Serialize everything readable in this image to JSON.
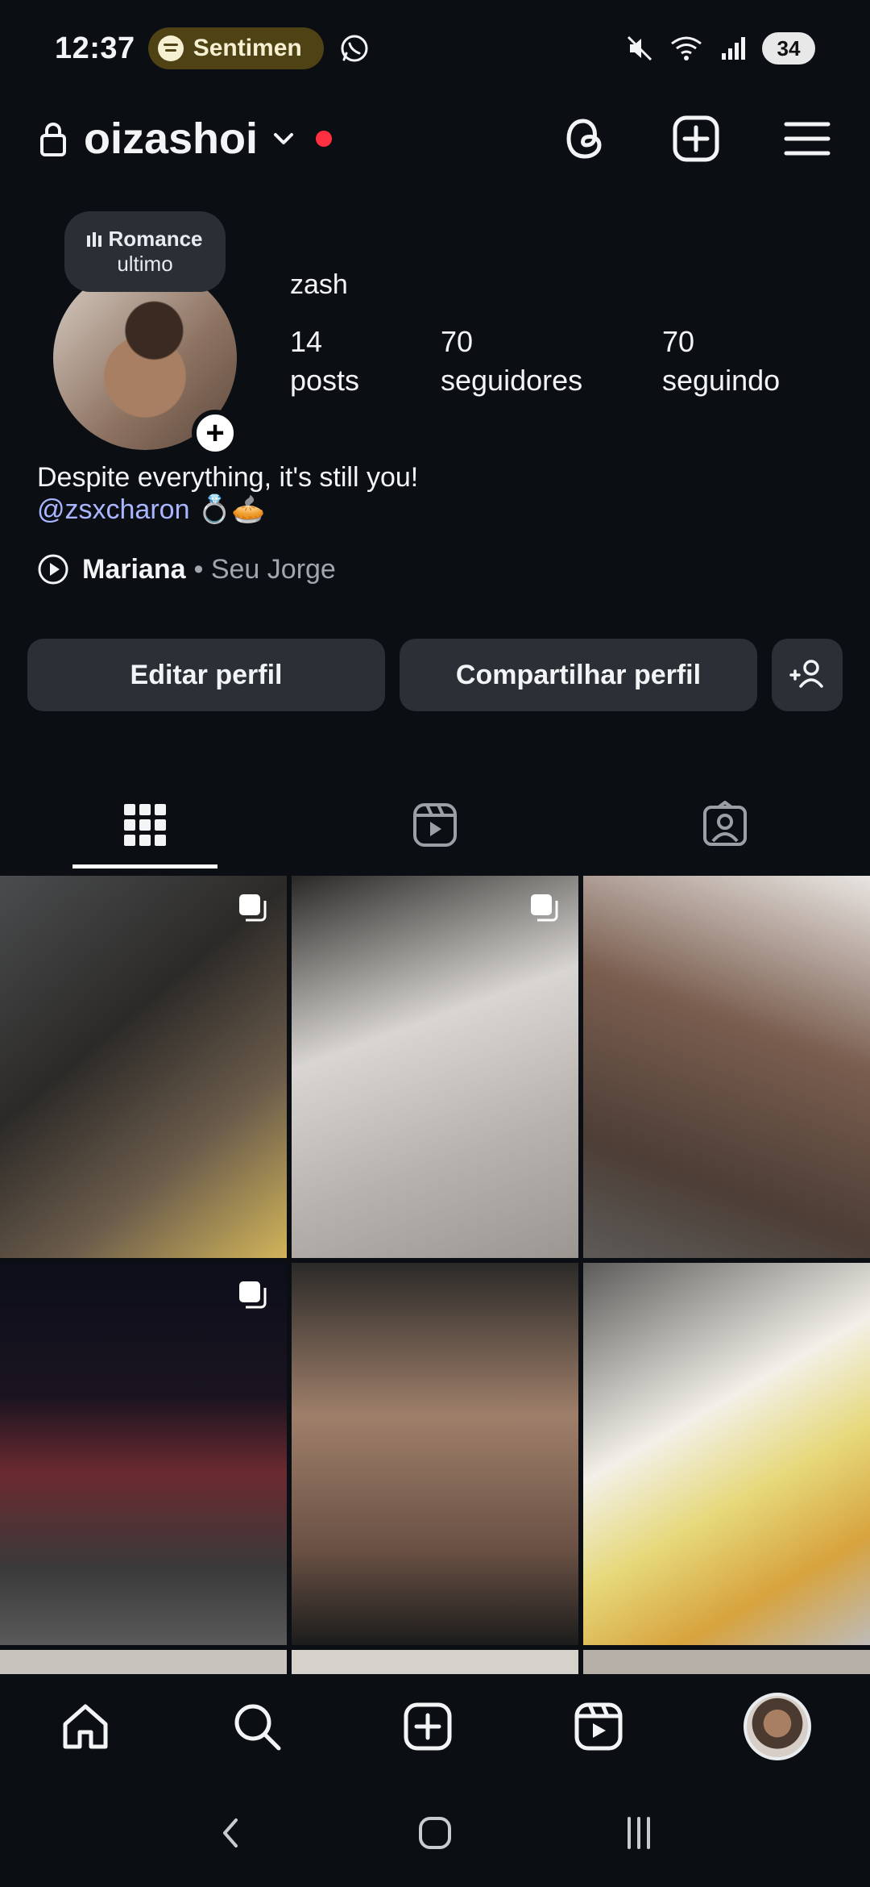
{
  "status_bar": {
    "time": "12:37",
    "spotify_text": "Sentimen",
    "battery": "34"
  },
  "header": {
    "username": "oizashoi"
  },
  "profile": {
    "note_title": "Romance",
    "note_sub": "ultimo",
    "display_name": "zash",
    "stats": [
      {
        "value": "14",
        "label": "posts"
      },
      {
        "value": "70",
        "label": "seguidores"
      },
      {
        "value": "70",
        "label": "seguindo"
      }
    ],
    "bio_line1": "Despite everything, it's still you!",
    "bio_mention": "@zsxcharon",
    "bio_emojis": "💍🥧",
    "music_song": "Mariana",
    "music_artist": "• Seu Jorge"
  },
  "buttons": {
    "edit": "Editar perfil",
    "share": "Compartilhar perfil"
  },
  "colors": {
    "background": "#0b0f14",
    "button_bg": "#2b3036",
    "mention": "#a9b6ff",
    "red_dot": "#ff3040",
    "spotify_pill": "#4f4214"
  }
}
